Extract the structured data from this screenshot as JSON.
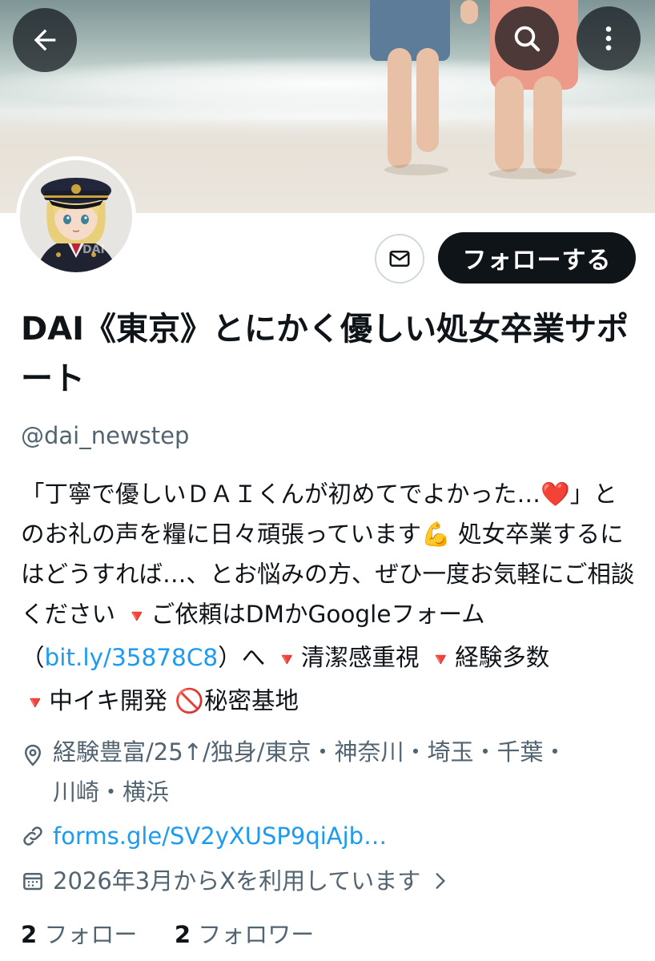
{
  "header": {
    "back_icon": "arrow-left-icon",
    "search_icon": "search-icon",
    "more_icon": "more-vertical-icon"
  },
  "profile": {
    "display_name": "DAI《東京》とにかく優しい処女卒業サポート",
    "handle": "@dai_newstep",
    "follow_label": "フォローする",
    "message_icon": "envelope-icon",
    "bio": {
      "part1": "「丁寧で優しいＤＡＩくんが初めてでよかった…❤️」とのお礼の声を糧に日々頑張っています💪 処女卒業するにはどうすれば…、とお悩みの方、ぜひ一度お気軽にご相談ください ",
      "bullet1": "🔻",
      "part2": "ご依頼はDMかGoogleフォーム（",
      "link": "bit.ly/35878C8",
      "part3": "）へ ",
      "bullet2": "🔻",
      "part4": "清潔感重視 ",
      "bullet3": "🔻",
      "part5": "経験多数",
      "bullet4": "🔻",
      "part6": "中イキ開発 ",
      "prohibited": "🚫",
      "part7": "秘密基地"
    },
    "location": "経験豊富/25↑/独身/東京・神奈川・埼玉・千葉・川崎・横浜",
    "website": "forms.gle/SV2yXUSP9qiAjb…",
    "joined": "2026年3月からXを利用しています",
    "following_count": "2",
    "following_label": "フォロー",
    "followers_count": "2",
    "followers_label": "フォロワー"
  },
  "colors": {
    "text": "#0f1419",
    "secondary": "#536471",
    "link": "#1d9bf0",
    "button_dark": "#0f1419"
  }
}
